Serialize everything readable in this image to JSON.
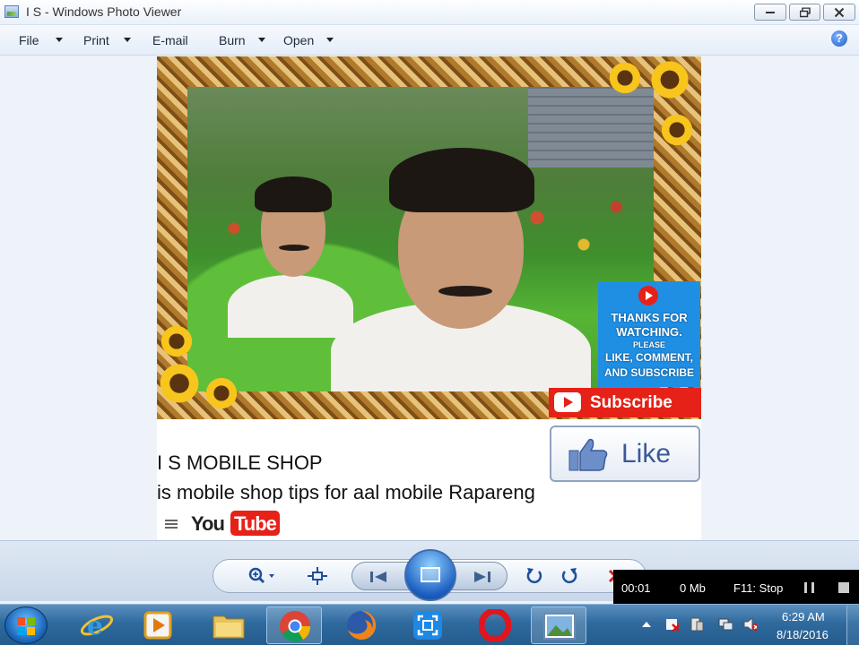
{
  "window": {
    "title": "I S - Windows Photo Viewer"
  },
  "menu": {
    "file": "File",
    "print": "Print",
    "email": "E-mail",
    "burn": "Burn",
    "open": "Open"
  },
  "photo": {
    "thanks_lines": [
      "THANKS FOR",
      "WATCHING.",
      "PLEASE",
      "LIKE, COMMENT,",
      "AND SUBSCRIBE"
    ],
    "subscribe_label": "Subscribe",
    "like_label": "Like",
    "caption_line1": "I S MOBILE SHOP",
    "caption_line2": "is mobile shop tips for aal mobile Rapareng",
    "youtube_you": "You",
    "youtube_tube": "Tube"
  },
  "recorder": {
    "time": "00:01",
    "size": "0 Mb",
    "stop_hint": "F11: Stop"
  },
  "taskbar": {
    "time": "6:29 AM",
    "date": "8/18/2016"
  },
  "colors": {
    "youtube_red": "#e62117",
    "thanks_blue": "#1f8fe3",
    "taskbar_blue": "#2f6a9e"
  },
  "icons": {
    "toolbar": [
      "zoom-icon",
      "fit-window-icon",
      "previous-icon",
      "slideshow-icon",
      "next-icon",
      "rotate-ccw-icon",
      "rotate-cw-icon",
      "delete-icon"
    ],
    "taskbar": [
      "internet-explorer-icon",
      "media-player-icon",
      "file-explorer-icon",
      "chrome-icon",
      "firefox-icon",
      "screen-recorder-icon",
      "opera-icon",
      "photo-viewer-icon"
    ]
  }
}
